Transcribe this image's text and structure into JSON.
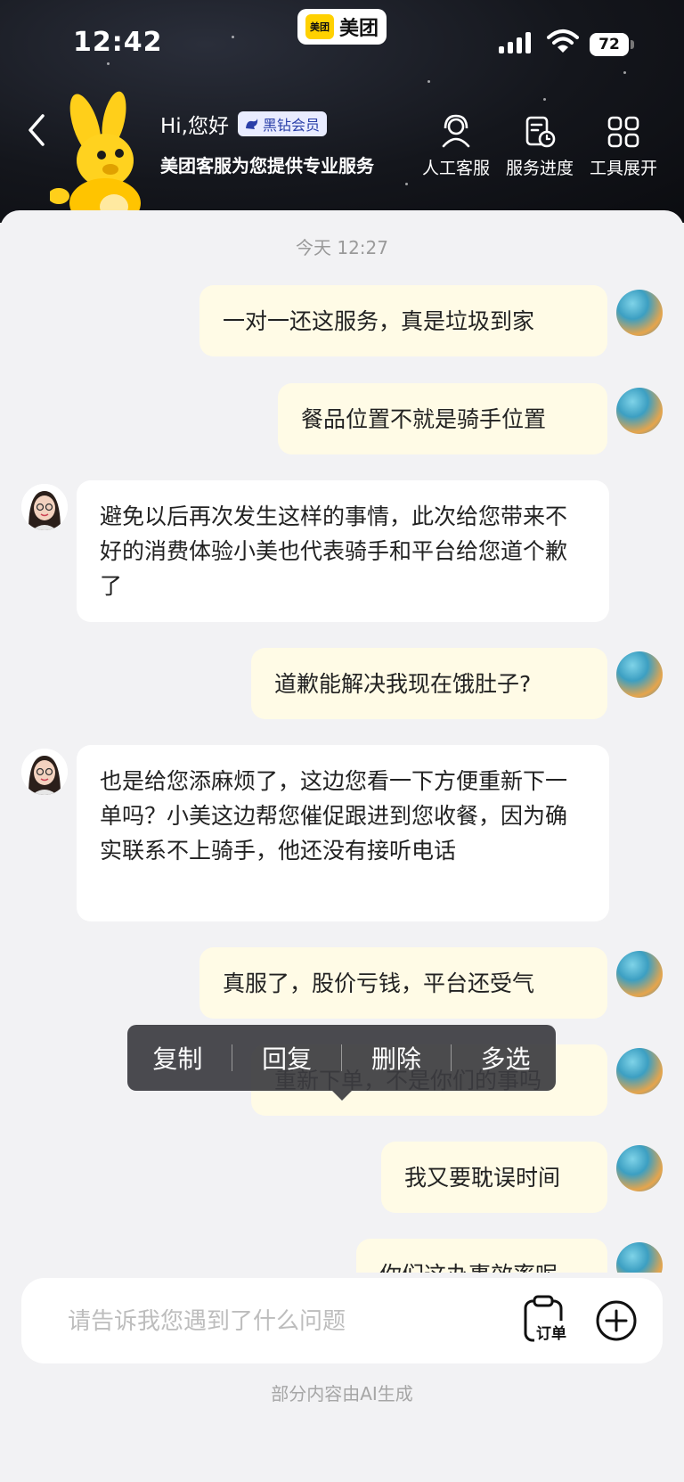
{
  "status_bar": {
    "time": "12:42",
    "app_badge": "美团",
    "app_badge_logo": "美团",
    "battery": "72"
  },
  "header": {
    "greeting": "Hi,您好",
    "vip_badge": "黑钻会员",
    "subtitle": "美团客服为您提供专业服务",
    "tools": [
      {
        "icon": "headset-icon",
        "label": "人工客服"
      },
      {
        "icon": "progress-clock-icon",
        "label": "服务进度"
      },
      {
        "icon": "grid-icon",
        "label": "工具展开"
      }
    ]
  },
  "chat": {
    "timestamp": "今天 12:27",
    "messages": [
      {
        "from": "me",
        "text": "一对一还这服务，真是垃圾到家"
      },
      {
        "from": "me",
        "text": "餐品位置不就是骑手位置"
      },
      {
        "from": "agent",
        "text": "避免以后再次发生这样的事情，此次给您带来不好的消费体验小美也代表骑手和平台给您道个歉了"
      },
      {
        "from": "me",
        "text": "道歉能解决我现在饿肚子?"
      },
      {
        "from": "agent",
        "text": "也是给您添麻烦了，这边您看一下方便重新下一单吗？小美这边帮您催促跟进到您收餐，因为确实联系不上骑手，他还没有接听电话"
      },
      {
        "from": "me",
        "text": "真服了，股价亏钱，平台还受气"
      },
      {
        "from": "me",
        "text": "重新下单，不是你们的事吗"
      },
      {
        "from": "me",
        "text": "我又要耽误时间"
      },
      {
        "from": "me",
        "text": "你们这办事效率呢"
      }
    ]
  },
  "context_menu": {
    "items": [
      "复制",
      "回复",
      "删除",
      "多选"
    ]
  },
  "input": {
    "placeholder": "请告诉我您遇到了什么问题",
    "order_label": "订单"
  },
  "footer": {
    "note": "部分内容由AI生成"
  },
  "colors": {
    "my_bubble": "#fffbe6",
    "agent_bubble": "#ffffff",
    "brand_yellow": "#ffd100"
  }
}
